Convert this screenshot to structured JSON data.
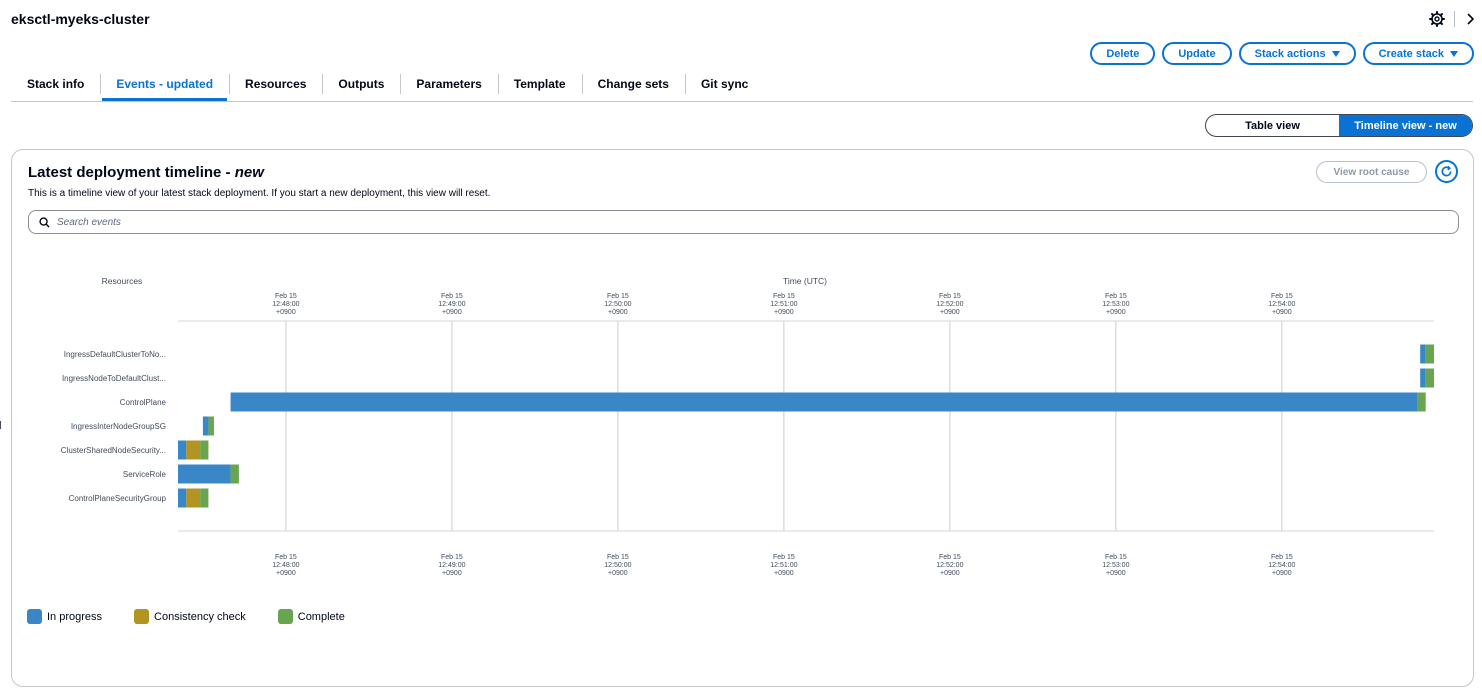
{
  "header": {
    "title": "eksctl-myeks-cluster"
  },
  "actions": {
    "delete": "Delete",
    "update": "Update",
    "stack_actions": "Stack actions",
    "create_stack": "Create stack"
  },
  "tabs": [
    {
      "label": "Stack info",
      "active": false
    },
    {
      "label": "Events - updated",
      "active": true
    },
    {
      "label": "Resources",
      "active": false
    },
    {
      "label": "Outputs",
      "active": false
    },
    {
      "label": "Parameters",
      "active": false
    },
    {
      "label": "Template",
      "active": false
    },
    {
      "label": "Change sets",
      "active": false
    },
    {
      "label": "Git sync",
      "active": false
    }
  ],
  "view_toggle": {
    "table": "Table view",
    "timeline": "Timeline view - new",
    "selected": "timeline"
  },
  "panel": {
    "title": "Latest deployment timeline - ",
    "title_suffix": "new",
    "description": "This is a timeline view of your latest stack deployment. If you start a new deployment, this view will reset.",
    "view_root_cause": "View root cause",
    "search_placeholder": "Search events"
  },
  "colors": {
    "in_progress": "#3a87c8",
    "consistency_check": "#b39420",
    "complete": "#69a550",
    "accent": "#0972d3"
  },
  "chart_data": {
    "type": "timeline",
    "y_axis_title": "Resources",
    "x_axis_title": "Time (UTC)",
    "x_ticks": [
      {
        "date": "Feb 15",
        "time": "12:48:00",
        "tz": "+0900"
      },
      {
        "date": "Feb 15",
        "time": "12:49:00",
        "tz": "+0900"
      },
      {
        "date": "Feb 15",
        "time": "12:50:00",
        "tz": "+0900"
      },
      {
        "date": "Feb 15",
        "time": "12:51:00",
        "tz": "+0900"
      },
      {
        "date": "Feb 15",
        "time": "12:52:00",
        "tz": "+0900"
      },
      {
        "date": "Feb 15",
        "time": "12:53:00",
        "tz": "+0900"
      },
      {
        "date": "Feb 15",
        "time": "12:54:00",
        "tz": "+0900"
      }
    ],
    "x_range": [
      "12:47:21",
      "12:54:55"
    ],
    "legend": [
      "In progress",
      "Consistency check",
      "Complete"
    ],
    "resources": [
      {
        "name": "IngressDefaultClusterToNo...",
        "segments": [
          {
            "state": "In progress",
            "start": "12:54:50",
            "end": "12:54:52"
          },
          {
            "state": "Complete",
            "start": "12:54:52",
            "end": "12:54:55"
          }
        ]
      },
      {
        "name": "IngressNodeToDefaultClust...",
        "segments": [
          {
            "state": "In progress",
            "start": "12:54:50",
            "end": "12:54:52"
          },
          {
            "state": "Complete",
            "start": "12:54:52",
            "end": "12:54:55"
          }
        ]
      },
      {
        "name": "ControlPlane",
        "segments": [
          {
            "state": "In progress",
            "start": "12:47:40",
            "end": "12:54:49"
          },
          {
            "state": "Complete",
            "start": "12:54:49",
            "end": "12:54:52"
          }
        ]
      },
      {
        "name": "IngressInterNodeGroupSG",
        "segments": [
          {
            "state": "In progress",
            "start": "12:47:30",
            "end": "12:47:32"
          },
          {
            "state": "Complete",
            "start": "12:47:32",
            "end": "12:47:34"
          }
        ]
      },
      {
        "name": "ClusterSharedNodeSecurity...",
        "segments": [
          {
            "state": "In progress",
            "start": "12:47:21",
            "end": "12:47:24"
          },
          {
            "state": "Consistency check",
            "start": "12:47:24",
            "end": "12:47:29"
          },
          {
            "state": "Complete",
            "start": "12:47:29",
            "end": "12:47:32"
          }
        ]
      },
      {
        "name": "ServiceRole",
        "segments": [
          {
            "state": "In progress",
            "start": "12:47:21",
            "end": "12:47:40"
          },
          {
            "state": "Complete",
            "start": "12:47:40",
            "end": "12:47:43"
          }
        ]
      },
      {
        "name": "ControlPlaneSecurityGroup",
        "segments": [
          {
            "state": "In progress",
            "start": "12:47:21",
            "end": "12:47:24"
          },
          {
            "state": "Consistency check",
            "start": "12:47:24",
            "end": "12:47:29"
          },
          {
            "state": "Complete",
            "start": "12:47:29",
            "end": "12:47:32"
          }
        ]
      }
    ]
  }
}
